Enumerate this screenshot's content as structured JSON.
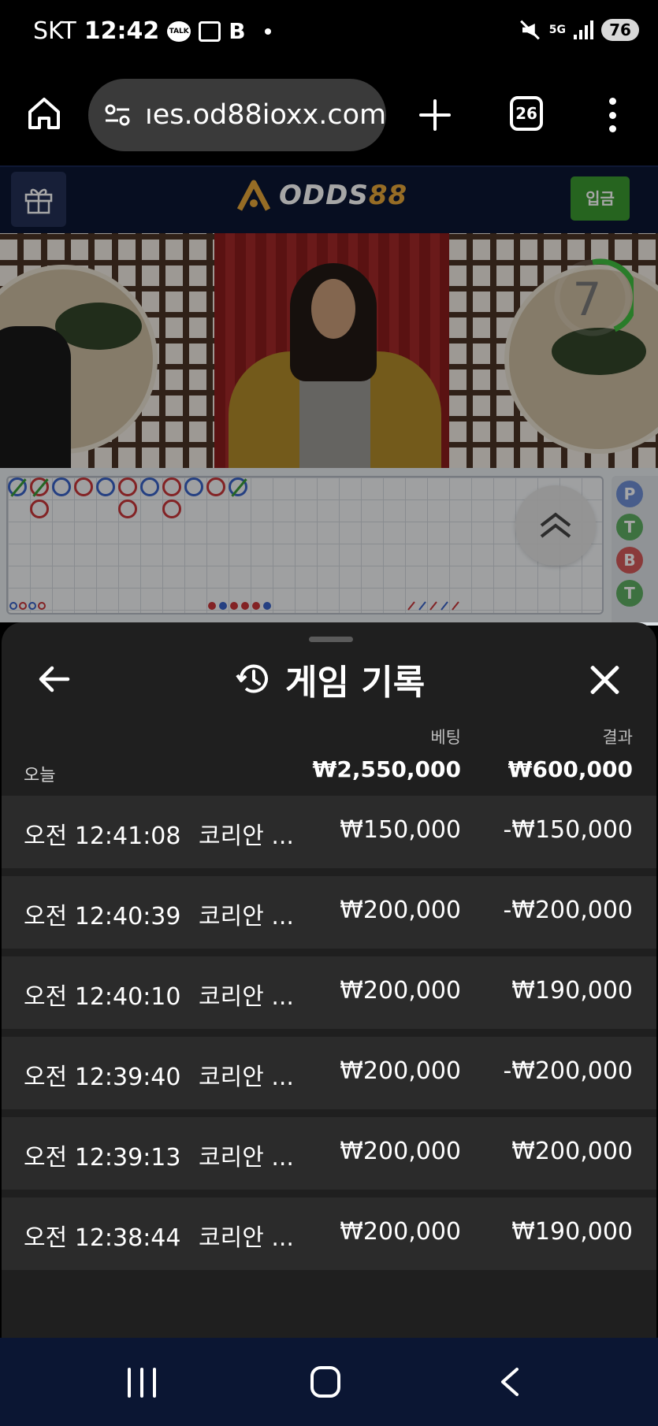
{
  "status_bar": {
    "carrier": "SKT",
    "time": "12:42",
    "talk_badge": "TALK",
    "b_icon": "B",
    "network": "5G",
    "battery": "76"
  },
  "browser": {
    "url": "ıes.od88ioxx.com",
    "tab_count": "26"
  },
  "site": {
    "logo_text": "ODDS",
    "logo_number": "88",
    "deposit_label": "입금"
  },
  "video": {
    "countdown": "7"
  },
  "roadmap": {
    "side_labels": [
      "P",
      "T",
      "B",
      "T"
    ]
  },
  "history": {
    "title": "게임 기록",
    "columns": {
      "bet": "베팅",
      "result": "결과"
    },
    "today_label": "오늘",
    "total_bet": "₩2,550,000",
    "total_result": "₩600,000",
    "rows": [
      {
        "time": "오전 12:41:08",
        "game": "코리안 ...",
        "bet": "₩150,000",
        "result": "-₩150,000"
      },
      {
        "time": "오전 12:40:39",
        "game": "코리안 ...",
        "bet": "₩200,000",
        "result": "-₩200,000"
      },
      {
        "time": "오전 12:40:10",
        "game": "코리안 ...",
        "bet": "₩200,000",
        "result": "₩190,000"
      },
      {
        "time": "오전 12:39:40",
        "game": "코리안 ...",
        "bet": "₩200,000",
        "result": "-₩200,000"
      },
      {
        "time": "오전 12:39:13",
        "game": "코리안 ...",
        "bet": "₩200,000",
        "result": "₩200,000"
      },
      {
        "time": "오전 12:38:44",
        "game": "코리안 ...",
        "bet": "₩200,000",
        "result": "₩190,000"
      }
    ]
  },
  "colors": {
    "site_header": "#0b1633",
    "deposit_green": "#3b9a31",
    "logo_gold": "#e7a73a",
    "sheet_bg": "#1f1f1f",
    "row_bg": "#2b2b2b",
    "banker_red": "#c9363a",
    "player_blue": "#3a63c8",
    "tie_green": "#3a9d3a",
    "timer_green": "#3fbf3f"
  },
  "icons": [
    "home-icon",
    "site-settings-icon",
    "new-tab-icon",
    "tab-switcher-icon",
    "more-menu-icon",
    "gift-icon",
    "scroll-up-icon",
    "back-arrow-icon",
    "history-icon",
    "close-icon",
    "recent-apps-icon",
    "nav-home-icon",
    "nav-back-icon"
  ]
}
